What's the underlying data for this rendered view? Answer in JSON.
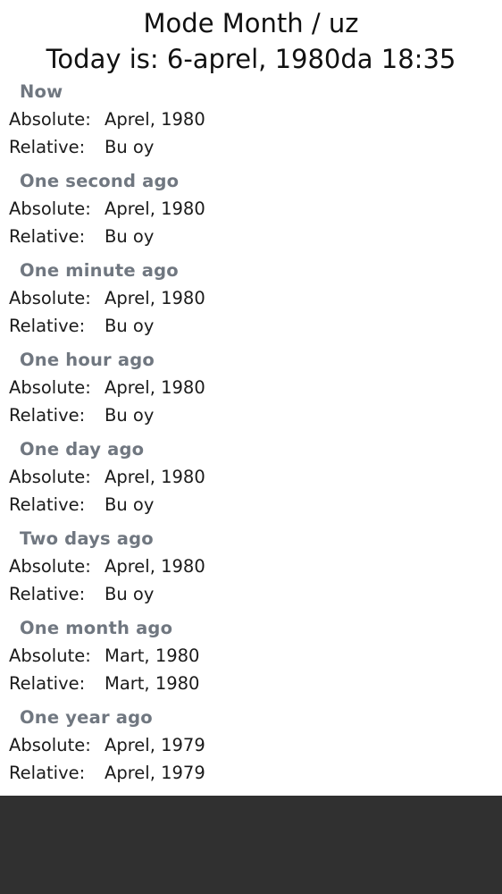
{
  "header": {
    "title": "Mode Month / uz",
    "subtitle": "Today is: 6-aprel, 1980da 18:35"
  },
  "labels": {
    "absolute": "Absolute:",
    "relative": "Relative:"
  },
  "sections": [
    {
      "title": "Now",
      "absolute": "Aprel, 1980",
      "relative": "Bu oy"
    },
    {
      "title": "One second ago",
      "absolute": "Aprel, 1980",
      "relative": "Bu oy"
    },
    {
      "title": "One minute ago",
      "absolute": "Aprel, 1980",
      "relative": "Bu oy"
    },
    {
      "title": "One hour ago",
      "absolute": "Aprel, 1980",
      "relative": "Bu oy"
    },
    {
      "title": "One day ago",
      "absolute": "Aprel, 1980",
      "relative": "Bu oy"
    },
    {
      "title": "Two days ago",
      "absolute": "Aprel, 1980",
      "relative": "Bu oy"
    },
    {
      "title": "One month ago",
      "absolute": "Mart, 1980",
      "relative": "Mart, 1980"
    },
    {
      "title": "One year ago",
      "absolute": "Aprel, 1979",
      "relative": "Aprel, 1979"
    }
  ],
  "colors": {
    "section_title": "#707780",
    "text": "#1a1a1a",
    "nav_bar": "#303030"
  }
}
